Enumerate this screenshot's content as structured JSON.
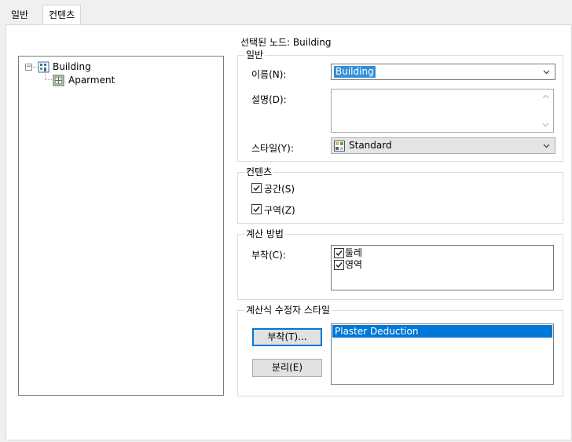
{
  "tabs": {
    "general": "일반",
    "contents": "컨텐츠"
  },
  "tree": {
    "root_label": "Building",
    "child_label": "Aparment"
  },
  "selected_node": "선택된 노드: Building",
  "general_group": {
    "legend": "일반",
    "name_label": "이름(N):",
    "name_value": "Building",
    "desc_label": "설명(D):",
    "desc_value": "",
    "style_label": "스타일(Y):",
    "style_value": "Standard"
  },
  "contents_group": {
    "legend": "컨텐츠",
    "space_label": "공간(S)",
    "space_checked": true,
    "zone_label": "구역(Z)",
    "zone_checked": true
  },
  "calc_group": {
    "legend": "계산 방법",
    "attach_label": "부착(C):",
    "items": [
      {
        "label": "둘레",
        "checked": true
      },
      {
        "label": "영역",
        "checked": true
      }
    ]
  },
  "modifier_group": {
    "legend": "계산식 수정자 스타일",
    "attach_button": "부착(T)...",
    "detach_button": "분리(E)",
    "selected_item": "Plaster Deduction"
  },
  "colors": {
    "selection": "#0078d7",
    "panel": "#ffffff",
    "window": "#f0f0f0"
  }
}
